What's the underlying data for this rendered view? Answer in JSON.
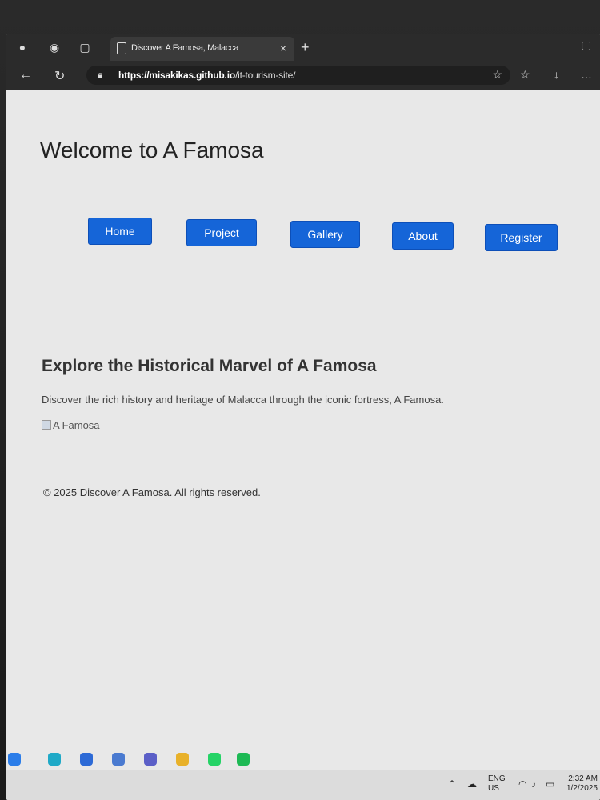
{
  "browser": {
    "tab_title": "Discover A Famosa, Malacca",
    "tab_close_icon": "×",
    "new_tab_icon": "+",
    "url_domain": "https://misakikas.github.io",
    "url_path": "/it-tourism-site/"
  },
  "page": {
    "heading": "Welcome to A Famosa",
    "nav": [
      "Home",
      "Project",
      "Gallery",
      "About",
      "Register"
    ],
    "section_title": "Explore the Historical Marvel of A Famosa",
    "description": "Discover the rich history and heritage of Malacca through the iconic fortress, A Famosa.",
    "image_alt": "A Famosa",
    "footer": "© 2025 Discover A Famosa. All rights reserved."
  },
  "taskbar": {
    "lang_top": "ENG",
    "lang_bottom": "US",
    "time": "2:32 AM",
    "date": "1/2/2025"
  },
  "colors": {
    "nav_button": "#1565d8",
    "page_bg": "#e8e8e8",
    "browser_chrome": "#2b2b2b"
  }
}
